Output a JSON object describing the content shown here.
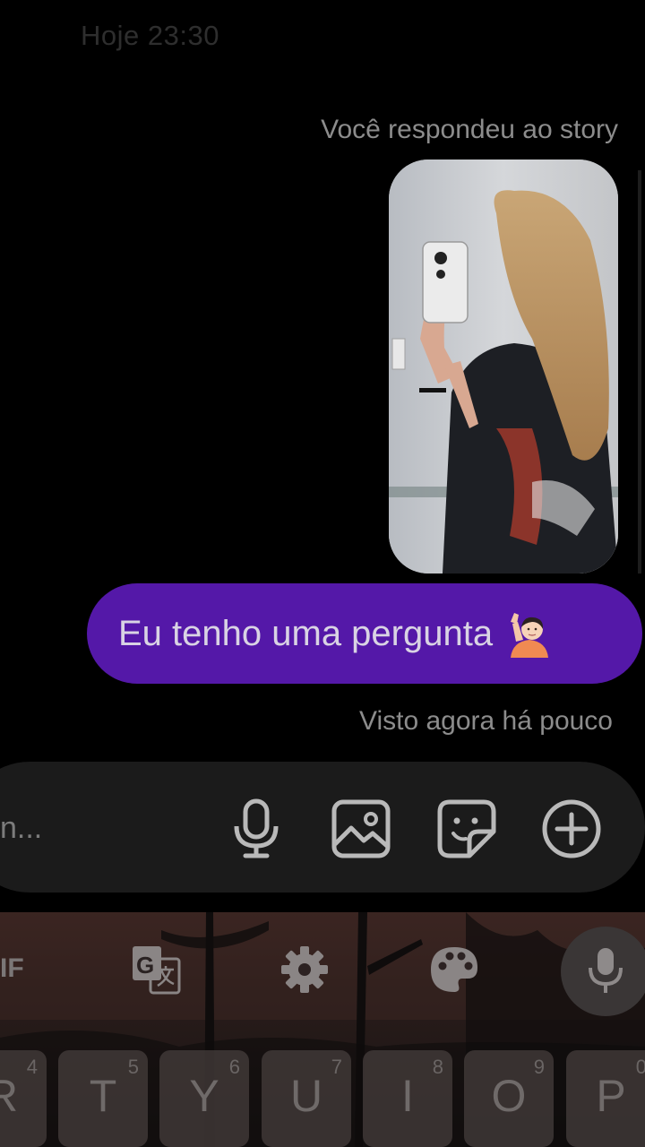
{
  "chat": {
    "timestamp": "Hoje 23:30",
    "story_reply_label": "Você respondeu ao story",
    "message": "Eu tenho uma pergunta",
    "message_emoji": "person-raising-hand-emoji",
    "seen_label": "Visto agora há pouco",
    "bubble_color": "#5418a8"
  },
  "composer": {
    "placeholder": "n...",
    "buttons": [
      "microphone-icon",
      "image-icon",
      "sticker-icon",
      "add-icon"
    ]
  },
  "keyboard": {
    "toolbar": {
      "gif_label": "IF",
      "items": [
        "translate-icon",
        "settings-gear-icon",
        "palette-icon",
        "voice-input-mic-icon"
      ]
    },
    "keys": [
      {
        "letter": "R",
        "num": "4"
      },
      {
        "letter": "T",
        "num": "5"
      },
      {
        "letter": "Y",
        "num": "6"
      },
      {
        "letter": "U",
        "num": "7"
      },
      {
        "letter": "I",
        "num": "8"
      },
      {
        "letter": "O",
        "num": "9"
      },
      {
        "letter": "P",
        "num": "0"
      }
    ]
  }
}
